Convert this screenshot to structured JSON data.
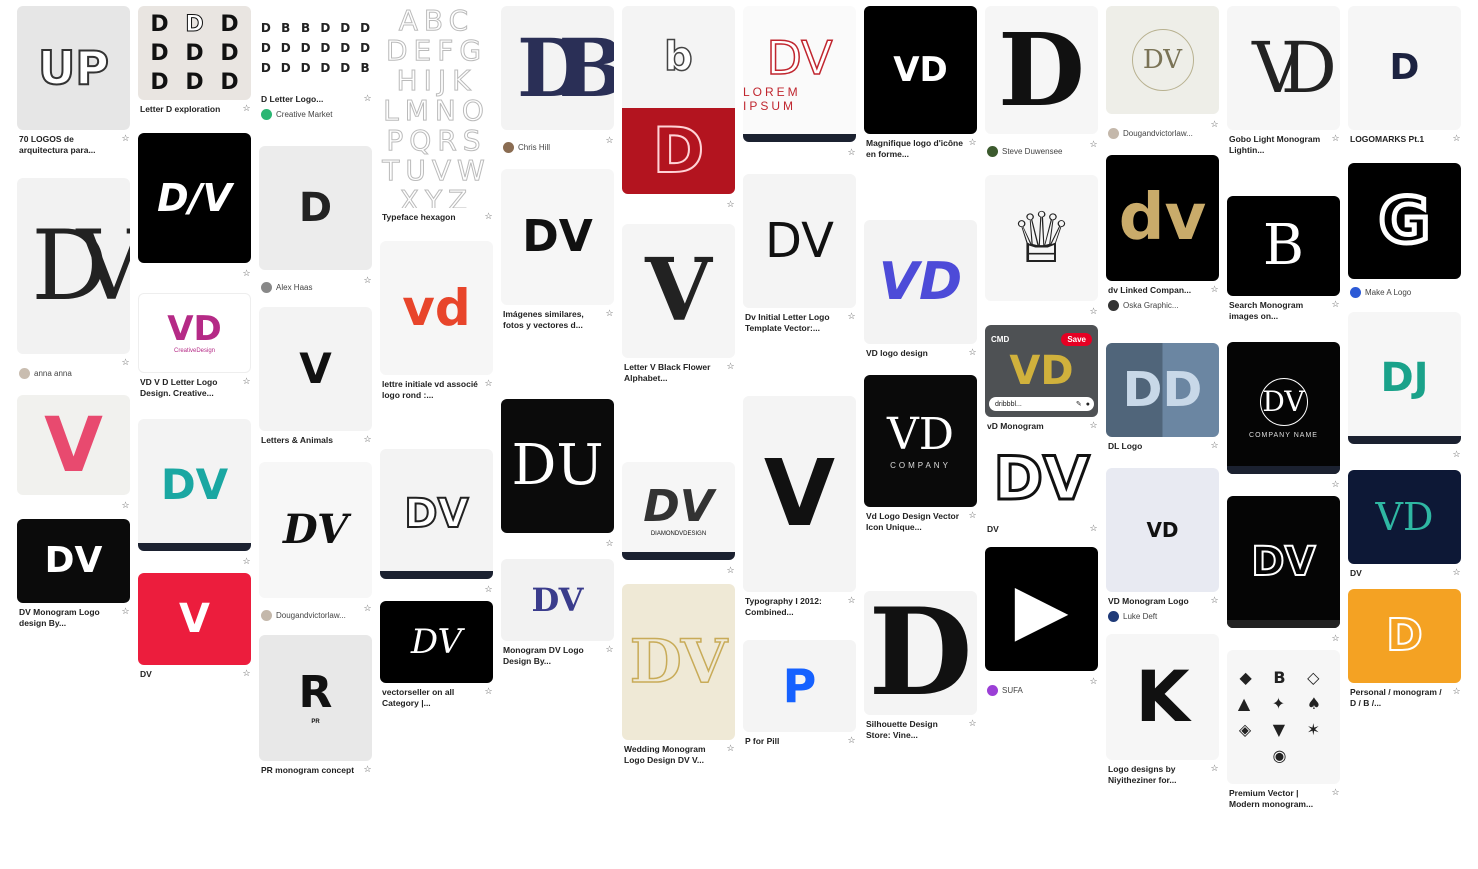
{
  "pins": {
    "c1": [
      {
        "glyph": "UP",
        "caption": "70 LOGOS de arquitectura para..."
      },
      {
        "glyph": "DV",
        "author": "anna anna"
      },
      {
        "glyph": "V"
      },
      {
        "glyph": "DV",
        "caption": "DV Monogram Logo design By..."
      }
    ],
    "c2": [
      {
        "caption": "Letter D exploration"
      },
      {
        "glyph": "D/V"
      },
      {
        "glyph": "VD",
        "sub": "CreativeDesign",
        "caption": "VD V D Letter Logo Design. Creative..."
      },
      {
        "glyph": "DV"
      },
      {
        "glyph": "V",
        "caption": "DV"
      }
    ],
    "c3": [
      {
        "caption": "D Letter Logo...",
        "author": "Creative Market"
      },
      {
        "glyph": "D",
        "author": "Alex Haas"
      },
      {
        "glyph": "V",
        "caption": "Letters & Animals"
      },
      {
        "glyph": "DV",
        "author": "Dougandvictorlaw..."
      },
      {
        "glyph": "R",
        "sub": "PR",
        "caption": "PR monogram concept"
      }
    ],
    "c4": [
      {
        "glyph": "ABC DEFG HIJK LMNO PQRS TUVW XYZ",
        "caption": "Typeface hexagon"
      },
      {
        "glyph": "vd",
        "caption": "lettre initiale vd associé logo rond :..."
      },
      {
        "glyph": "DV"
      },
      {
        "glyph": "DV",
        "caption": "vectorseller on all Category |..."
      }
    ],
    "c5": [
      {
        "glyph": "DB",
        "author": "Chris Hill"
      },
      {
        "glyph": "DV",
        "caption": "Imágenes similares, fotos y vectores d..."
      },
      {
        "glyph": "DU"
      },
      {
        "glyph": "DV",
        "caption": "Monogram DV Logo Design By..."
      }
    ],
    "c6": [
      {
        "glyph": "b"
      },
      {
        "glyph": "D"
      },
      {
        "glyph": "V",
        "caption": "Letter V Black Flower Alphabet..."
      },
      {
        "glyph": "DV",
        "sub": "DIAMONDVDESIGN"
      },
      {
        "glyph": "DV",
        "caption": "Wedding Monogram Logo Design DV V..."
      }
    ],
    "c7": [
      {
        "glyph": "DV",
        "sub": "LOREM IPSUM"
      },
      {
        "glyph": "DV",
        "caption": "Dv Initial Letter Logo Template Vector:..."
      },
      {
        "glyph": "V",
        "caption": "Typography I 2012: Combined..."
      },
      {
        "glyph": "P",
        "caption": "P for Pill"
      }
    ],
    "c8": [
      {
        "glyph": "VD",
        "caption": "Magnifique logo d'icône en forme..."
      },
      {
        "glyph": "VD",
        "caption": "VD logo design"
      },
      {
        "glyph": "VD",
        "sub": "COMPANY",
        "caption": "Vd Logo Design Vector Icon Unique..."
      },
      {
        "glyph": "D",
        "caption": "Silhouette Design Store: Vine..."
      }
    ],
    "c9": [
      {
        "glyph": "D",
        "author": "Steve Duwensee"
      },
      {
        "glyph": "♕"
      },
      {
        "glyph": "VD",
        "cmd": "CMD",
        "save": "Save",
        "dribbble": "dribbbl...",
        "caption": "vD Monogram"
      },
      {
        "glyph": "DV",
        "caption": "DV"
      },
      {
        "glyph": "▶",
        "author": "SUFA"
      }
    ],
    "c10": [
      {
        "glyph": "DV",
        "author": "Dougandvictorlaw..."
      },
      {
        "glyph": "dv",
        "caption": "dv Linked Compan...",
        "author": "Oska Graphic..."
      },
      {
        "glyph": "DD",
        "caption": "DL Logo"
      },
      {
        "glyph": "VD",
        "caption": "VD Monogram Logo",
        "author": "Luke Deft"
      },
      {
        "glyph": "K",
        "caption": "Logo designs by Niyitheziner for..."
      }
    ],
    "c11": [
      {
        "glyph": "VD",
        "caption": "Gobo Light Monogram Lightin..."
      },
      {
        "glyph": "B",
        "caption": "Search Monogram images on..."
      },
      {
        "glyph": "DV",
        "sub": "COMPANY NAME"
      },
      {
        "glyph": "DV"
      },
      {
        "glyph": "◆ B ◇ ▲ ✦ ♠ ◈ ▼ ✶ ◉",
        "caption": "Premium Vector | Modern monogram..."
      }
    ],
    "c12": [
      {
        "glyph": "D",
        "caption": "LOGOMARKS Pt.1"
      },
      {
        "glyph": "G",
        "author": "Make A Logo"
      },
      {
        "glyph": "DJ"
      },
      {
        "glyph": "VD",
        "caption": "DV"
      },
      {
        "glyph": "D",
        "caption": "Personal / monogram / D / B /..."
      }
    ]
  },
  "colors": {
    "pinterest_red": "#e60023",
    "teal": "#1aa7a2",
    "orange": "#f4a223",
    "navy": "#0d1836"
  }
}
